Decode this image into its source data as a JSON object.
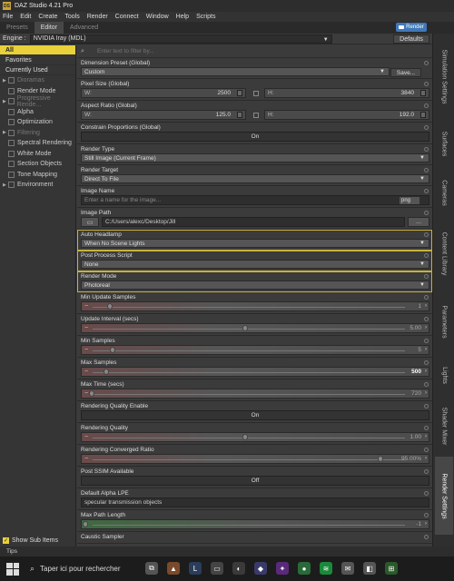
{
  "window": {
    "title": "DAZ Studio 4.21 Pro",
    "logo": "DS"
  },
  "menu": [
    "File",
    "Edit",
    "Create",
    "Tools",
    "Render",
    "Connect",
    "Window",
    "Help",
    "Scripts"
  ],
  "tabs": [
    "Presets",
    "Editor",
    "Advanced"
  ],
  "render_button": "Render",
  "engine": {
    "label": "Engine :",
    "value": "NVIDIA Iray (MDL)",
    "defaults": "Defaults"
  },
  "sidebar": {
    "top": [
      "All",
      "Favorites",
      "Currently Used"
    ],
    "sections": [
      {
        "label": "Dioramas",
        "arrow": true,
        "box": true,
        "dim": true
      },
      {
        "label": "Render Mode",
        "arrow": false,
        "box": true,
        "dim": false
      },
      {
        "label": "Progressive Rende...",
        "arrow": true,
        "box": true,
        "dim": true
      },
      {
        "label": "Alpha",
        "arrow": false,
        "box": true,
        "dim": false
      },
      {
        "label": "Optimization",
        "arrow": false,
        "box": true,
        "dim": false
      },
      {
        "label": "Filtering",
        "arrow": true,
        "box": true,
        "dim": true
      },
      {
        "label": "Spectral Rendering",
        "arrow": false,
        "box": true,
        "dim": false
      },
      {
        "label": "White Mode",
        "arrow": false,
        "box": true,
        "dim": false
      },
      {
        "label": "Section Objects",
        "arrow": false,
        "box": true,
        "dim": false
      },
      {
        "label": "Tone Mapping",
        "arrow": false,
        "box": true,
        "dim": false
      },
      {
        "label": "Environment",
        "arrow": true,
        "box": true,
        "dim": false
      }
    ],
    "show_sub_items": "Show Sub Items"
  },
  "filter_placeholder": "Enter text to filter by...",
  "props": {
    "dimension_preset": {
      "label": "Dimension Preset (Global)",
      "value": "Custom",
      "save": "Save..."
    },
    "pixel_size": {
      "label": "Pixel Size (Global)",
      "w": "2500",
      "h": "3840",
      "wl": "W:",
      "hl": "H:"
    },
    "aspect_ratio": {
      "label": "Aspect Ratio (Global)",
      "w": "125.0",
      "h": "192.0",
      "wl": "W:",
      "hl": "H:"
    },
    "constrain": {
      "label": "Constrain Proportions (Global)",
      "value": "On"
    },
    "render_type": {
      "label": "Render Type",
      "value": "Still Image (Current Frame)"
    },
    "render_target": {
      "label": "Render Target",
      "value": "Direct To File"
    },
    "image_name": {
      "label": "Image Name",
      "placeholder": "Enter a name for the image...",
      "format": "png"
    },
    "image_path": {
      "label": "Image Path",
      "value": "C:/Users/alexc/Desktop/Jill",
      "more": "..."
    },
    "auto_headlamp": {
      "label": "Auto Headlamp",
      "value": "When No Scene Lights"
    },
    "post_process": {
      "label": "Post Process Script",
      "value": "None"
    },
    "render_mode": {
      "label": "Render Mode",
      "value": "Photoreal"
    },
    "min_update_samples": {
      "label": "Min Update Samples",
      "value": "1"
    },
    "update_interval": {
      "label": "Update Interval (secs)",
      "value": "5.00"
    },
    "min_samples": {
      "label": "Min Samples",
      "value": "5"
    },
    "max_samples": {
      "label": "Max Samples",
      "value": "500"
    },
    "max_time": {
      "label": "Max Time (secs)",
      "value": "720"
    },
    "quality_enable": {
      "label": "Rendering Quality Enable",
      "value": "On"
    },
    "quality": {
      "label": "Rendering Quality",
      "value": "1.00"
    },
    "converged_ratio": {
      "label": "Rendering Converged Ratio",
      "value": "95.00%"
    },
    "post_ssim": {
      "label": "Post SSIM Available",
      "value": "Off"
    },
    "alpha_lpe": {
      "label": "Default Alpha LPE",
      "value": "specular transmission objects"
    },
    "max_path_length": {
      "label": "Max Path Length",
      "value": "-1"
    },
    "caustic_sampler": {
      "label": "Caustic Sampler"
    }
  },
  "right_tabs": [
    "Simulation Settings",
    "Surfaces",
    "Cameras",
    "Content Library",
    "Parameters",
    "Lights",
    "Shader Mixer",
    "Render Settings"
  ],
  "tips": "Tips",
  "taskbar": {
    "search": "Taper ici pour rechercher"
  }
}
